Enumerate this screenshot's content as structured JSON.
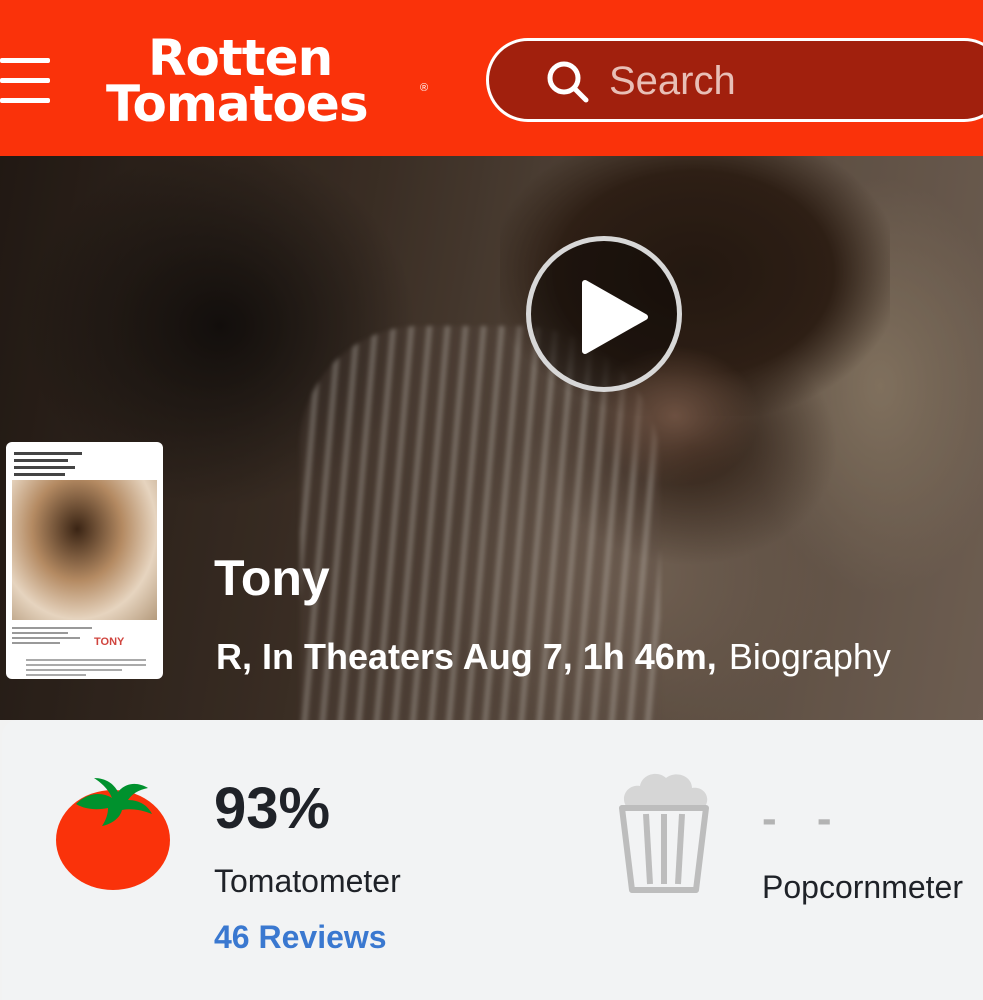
{
  "header": {
    "logo_line1": "Rotten",
    "logo_line2": "Tomatoes",
    "search": {
      "placeholder": "Search"
    },
    "icons": {
      "menu": "hamburger-menu-icon",
      "search": "magnifier-icon"
    }
  },
  "hero": {
    "play_icon": "play-icon",
    "poster": {
      "title": "TONY"
    },
    "movie": {
      "title": "Tony",
      "meta": "R, In Theaters Aug 7, 1h 46m,",
      "genre": "Biography"
    }
  },
  "scores": {
    "tomatometer": {
      "score": "93%",
      "label": "Tomatometer",
      "reviews": "46 Reviews",
      "icon": "fresh-tomato-icon"
    },
    "popcornmeter": {
      "score": "- -",
      "label": "Popcornmeter",
      "icon": "empty-popcorn-bucket-icon"
    }
  },
  "colors": {
    "brand": "#fa320a",
    "search_bg": "#a1200d",
    "link": "#3a78d0",
    "tomato": "#fa320a",
    "leaf": "#00912d"
  }
}
